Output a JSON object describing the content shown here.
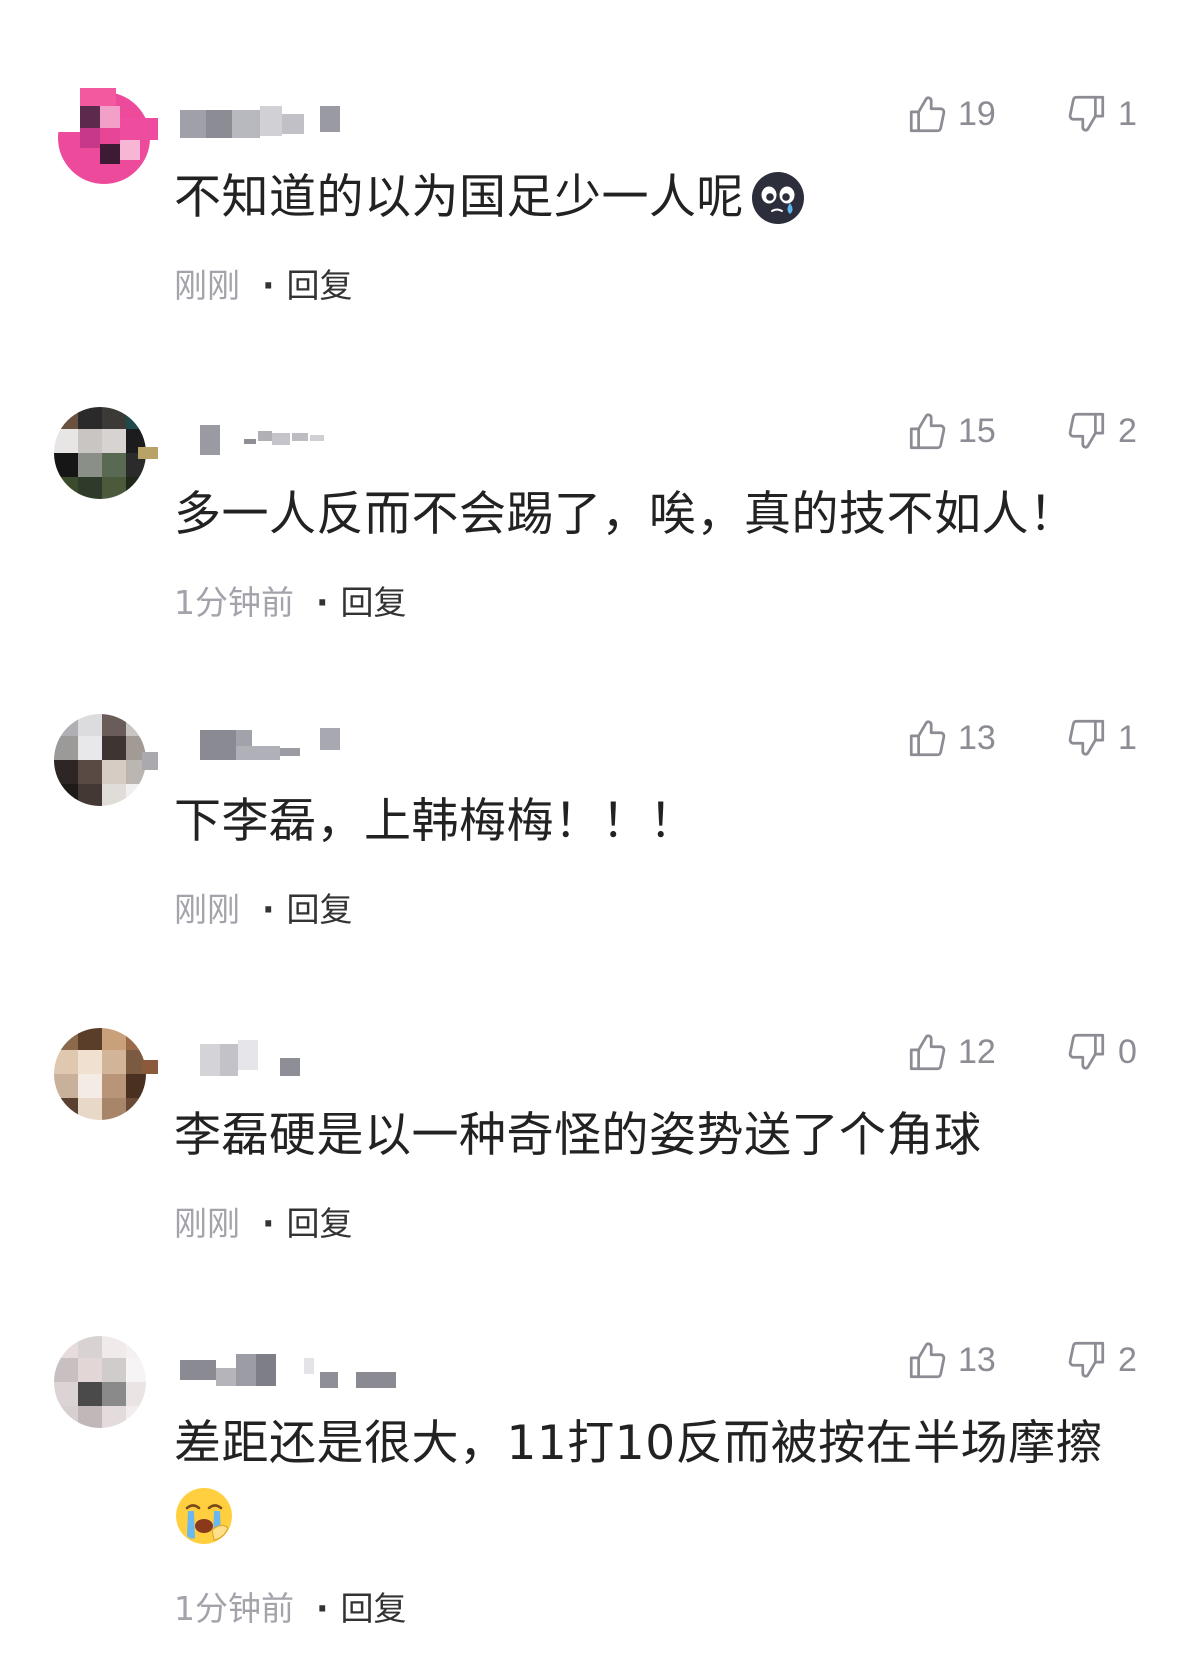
{
  "comments": [
    {
      "likes": "19",
      "dislikes": "1",
      "text": "不知道的以为国足少一人呢",
      "emoji": "dark-crying-face-emoji",
      "time": "刚刚",
      "separator": "·",
      "reply_label": "回复"
    },
    {
      "likes": "15",
      "dislikes": "2",
      "text": "多一人反而不会踢了，唉，真的技不如人！",
      "time": "1分钟前",
      "separator": "·",
      "reply_label": "回复"
    },
    {
      "likes": "13",
      "dislikes": "1",
      "text": "下李磊，上韩梅梅！！！",
      "time": "刚刚",
      "separator": "·",
      "reply_label": "回复"
    },
    {
      "likes": "12",
      "dislikes": "0",
      "text": "李磊硬是以一种奇怪的姿势送了个角球",
      "time": "刚刚",
      "separator": "·",
      "reply_label": "回复"
    },
    {
      "likes": "13",
      "dislikes": "2",
      "text": "差距还是很大，11打10反而被按在半场摩擦",
      "emoji": "loudly-crying-face-emoji",
      "time": "1分钟前",
      "separator": "·",
      "reply_label": "回复"
    }
  ],
  "icons": {
    "like": "thumbs-up-icon",
    "dislike": "thumbs-down-icon",
    "avatar": "pixelated-avatar",
    "username": "pixelated-username"
  },
  "colors": {
    "text": "#222222",
    "meta": "#a3a3ab",
    "icon": "#8c8c94",
    "reply": "#333333"
  }
}
